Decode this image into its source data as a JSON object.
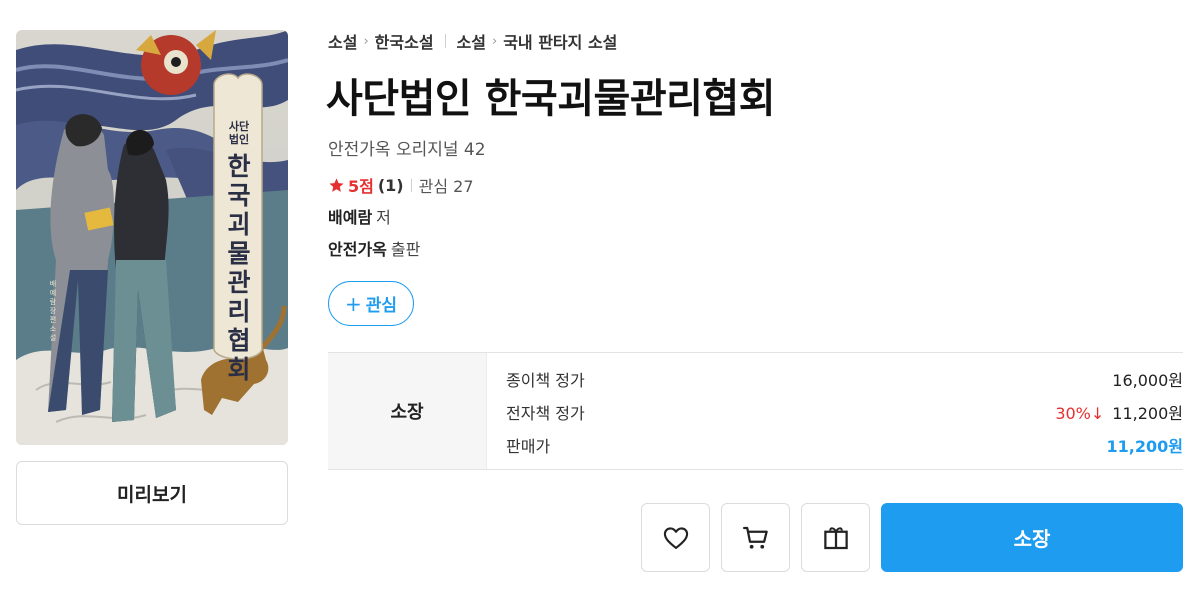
{
  "cover": {
    "title_lettering_small": "사단법인",
    "title_lettering_big": "한국괴물관리협회",
    "author_lettering": "배예람 장편소설"
  },
  "preview_label": "미리보기",
  "breadcrumb": {
    "group1": [
      "소설",
      "한국소설"
    ],
    "group2": [
      "소설",
      "국내 판타지 소설"
    ]
  },
  "title": "사단법인 한국괴물관리협회",
  "series": "안전가옥 오리지널 42",
  "rating": {
    "score": "5점",
    "count": "(1)",
    "interest": "관심 27",
    "star_color": "#e5302f"
  },
  "author": {
    "name": "배예람",
    "role": "저"
  },
  "publisher": {
    "name": "안전가옥",
    "role": "출판"
  },
  "wish_button": {
    "icon": "plus-icon",
    "label": "관심"
  },
  "price": {
    "head": "소장",
    "rows": [
      {
        "label": "종이책 정가",
        "value": "16,000원"
      },
      {
        "label": "전자책 정가",
        "discount": "30%↓",
        "value": "11,200원"
      },
      {
        "label": "판매가",
        "value": "11,200원"
      }
    ]
  },
  "actions": {
    "icons": [
      "heart-icon",
      "cart-icon",
      "gift-icon"
    ],
    "own_label": "소장"
  },
  "colors": {
    "accent": "#1e9cf0",
    "discount": "#e5302f"
  }
}
